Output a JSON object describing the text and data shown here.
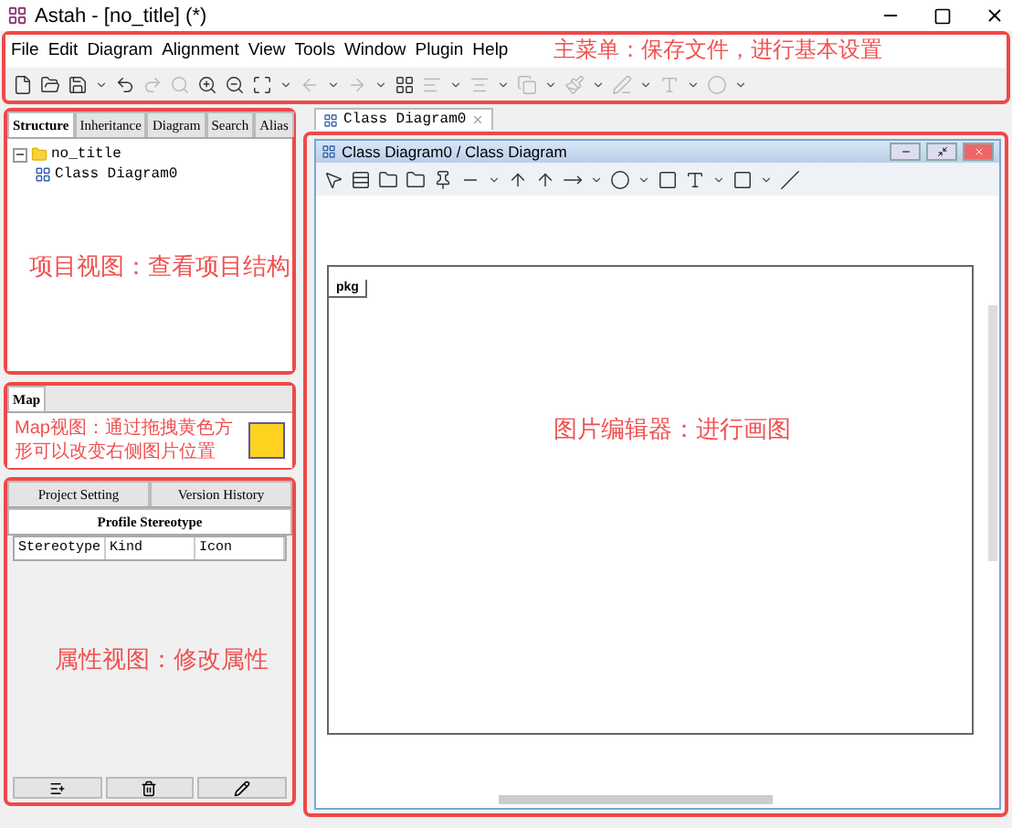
{
  "window": {
    "title": "Astah - [no_title] (*)"
  },
  "menu": [
    "File",
    "Edit",
    "Diagram",
    "Alignment",
    "View",
    "Tools",
    "Window",
    "Plugin",
    "Help"
  ],
  "annotations": {
    "menu": "主菜单：保存文件，进行基本设置",
    "project": "项目视图：查看项目结构",
    "map": "Map视图：通过拖拽黄色方形可以改变右侧图片位置",
    "properties": "属性视图：修改属性",
    "editor": "图片编辑器：进行画图"
  },
  "project_tabs": [
    {
      "label": "Structure",
      "selected": true
    },
    {
      "label": "Inheritance",
      "selected": false
    },
    {
      "label": "Diagram",
      "selected": false
    },
    {
      "label": "Search",
      "selected": false
    },
    {
      "label": "Alias",
      "selected": false
    }
  ],
  "tree": [
    {
      "label": "no_title",
      "expanded": true,
      "children": [
        {
          "label": "Class Diagram0"
        }
      ]
    }
  ],
  "map_tab": "Map",
  "property_tabs_top": [
    {
      "label": "Project Setting",
      "selected": false
    },
    {
      "label": "Version History",
      "selected": false
    }
  ],
  "property_tab": {
    "label": "Profile Stereotype",
    "selected": true
  },
  "table": {
    "columns": [
      "Stereotype",
      "Kind",
      "Icon"
    ]
  },
  "editor_tab": "Class Diagram0",
  "diagram_window": {
    "title": "Class Diagram0 / Class Diagram"
  },
  "frame_label": "pkg"
}
